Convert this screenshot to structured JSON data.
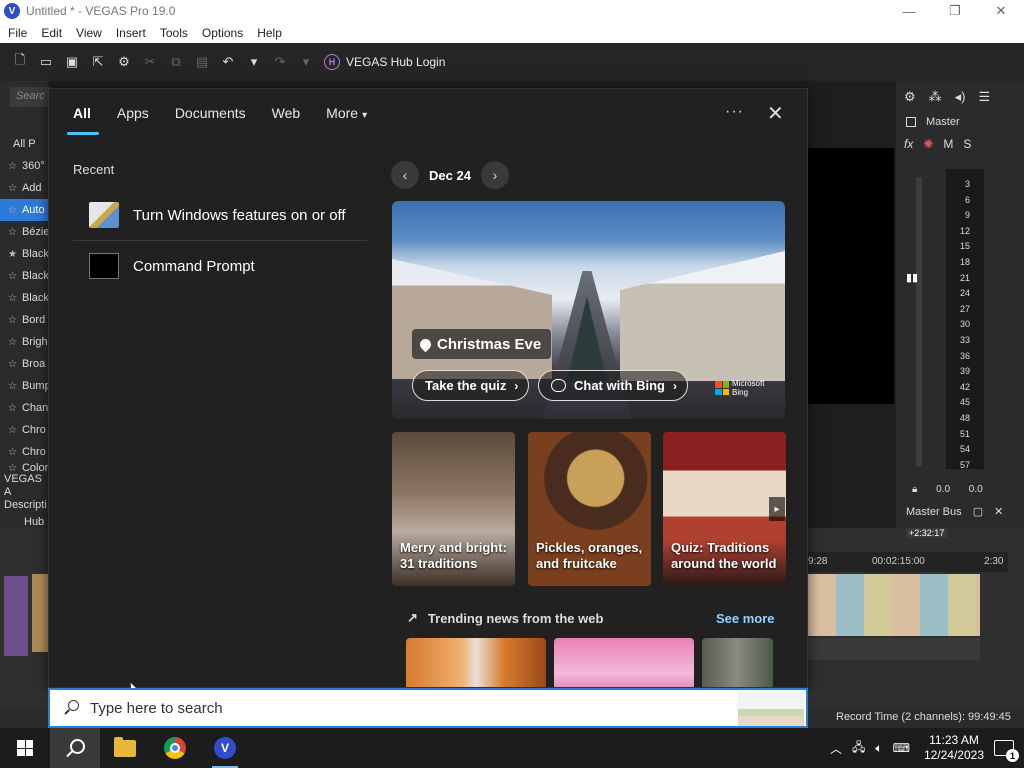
{
  "window": {
    "title": "Untitled * - VEGAS Pro 19.0",
    "logo_letter": "V",
    "minimize": "—",
    "maximize": "❐",
    "close": "✕"
  },
  "menubar": {
    "items": [
      "File",
      "Edit",
      "View",
      "Insert",
      "Tools",
      "Options",
      "Help"
    ]
  },
  "toolbar": {
    "hub_icon_letter": "H",
    "hub_login_label": "VEGAS Hub Login"
  },
  "left_panel": {
    "search_placeholder": "Searc",
    "fx_items": [
      {
        "label": "All P",
        "star": ""
      },
      {
        "label": "360°",
        "star": "☆"
      },
      {
        "label": "Add",
        "star": "☆"
      },
      {
        "label": "Auto",
        "star": "☆"
      },
      {
        "label": "Bézie",
        "star": "☆"
      },
      {
        "label": "Black",
        "star": "★"
      },
      {
        "label": "Black",
        "star": "☆"
      },
      {
        "label": "Black",
        "star": "☆"
      },
      {
        "label": "Bord",
        "star": "☆"
      },
      {
        "label": "Brigh",
        "star": "☆"
      },
      {
        "label": "Broa",
        "star": "☆"
      },
      {
        "label": "Bump",
        "star": "☆"
      },
      {
        "label": "Chan",
        "star": "☆"
      },
      {
        "label": "Chro",
        "star": "☆"
      },
      {
        "label": "Chro",
        "star": "☆"
      },
      {
        "label": "Color",
        "star": "☆"
      }
    ],
    "bottom_label_1": "VEGAS A",
    "bottom_label_2": "Descripti",
    "bottom_label_3": "Hub"
  },
  "right_panel": {
    "master_label": "Master",
    "fx_label": "fx",
    "m_label": "M",
    "s_label": "S",
    "db_scale": [
      "3",
      "6",
      "9",
      "12",
      "15",
      "18",
      "21",
      "24",
      "27",
      "30",
      "33",
      "36",
      "39",
      "42",
      "45",
      "48",
      "51",
      "54",
      "57"
    ],
    "readout_left": "0.0",
    "readout_right": "0.0",
    "master_bus_label": "Master Bus"
  },
  "timeline": {
    "ruler_time_1": "9:28",
    "ruler_time_2": "00:02:15:00",
    "ruler_time_3": "2:30",
    "track_time": "+2:32:17",
    "record_time": "Record Time (2 channels): 99:49:45"
  },
  "start_menu": {
    "tabs": [
      "All",
      "Apps",
      "Documents",
      "Web",
      "More"
    ],
    "active_tab": "All",
    "more_caret": "▾",
    "options_label": "···",
    "close_label": "✕",
    "recent_header": "Recent",
    "recent_items": [
      {
        "label": "Turn Windows features on or off",
        "icon": "windows-features-icon"
      },
      {
        "label": "Command Prompt",
        "icon": "command-prompt-icon"
      }
    ],
    "date_label": "Dec 24",
    "date_prev": "‹",
    "date_next": "›",
    "hero": {
      "title": "Christmas Eve",
      "quiz_button": "Take the quiz",
      "bing_button": "Chat with Bing",
      "brand_line_1": "Microsoft",
      "brand_line_2": "Bing"
    },
    "tiles": [
      {
        "caption": "Merry and bright: 31 traditions"
      },
      {
        "caption": "Pickles, oranges, and fruitcake"
      },
      {
        "caption": "Quiz: Traditions around the world"
      }
    ],
    "tile_next": "▸",
    "trending_header": "Trending news from the web",
    "see_more": "See more"
  },
  "searchbox": {
    "placeholder": "Type here to search"
  },
  "taskbar": {
    "apps": [
      "start-button",
      "search-button",
      "file-explorer",
      "google-chrome",
      "vegas-pro"
    ],
    "clock_time": "11:23 AM",
    "clock_date": "12/24/2023",
    "notification_count": "1"
  }
}
